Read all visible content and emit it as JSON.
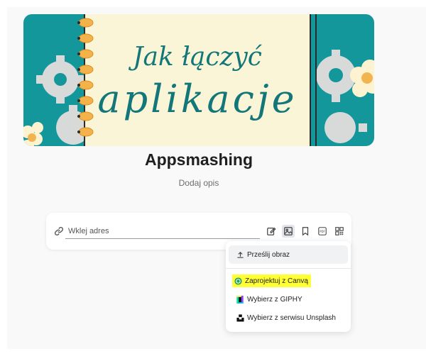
{
  "banner": {
    "line1": "Jak łączyć",
    "line2": "aplikacje",
    "colors": {
      "teal": "#14979b",
      "paper": "#fbf5d7",
      "spiral": "#f4b24a",
      "ink": "#13777a"
    }
  },
  "board": {
    "title": "Appsmashing",
    "description_placeholder": "Dodaj opis"
  },
  "link_input": {
    "placeholder": "Wklej adres"
  },
  "toolbar": {
    "icons": [
      "edit-icon",
      "image-icon",
      "bookmark-icon",
      "pdf-icon",
      "qr-code-icon"
    ],
    "pdf_label": "PDF",
    "active": "image-icon"
  },
  "image_menu": {
    "upload": "Prześlij obraz",
    "canva": "Zaprojektuj z Canvą",
    "giphy": "Wybierz z GIPHY",
    "unsplash": "Wybierz z serwisu Unsplash",
    "highlight_color": "#ffff33"
  }
}
